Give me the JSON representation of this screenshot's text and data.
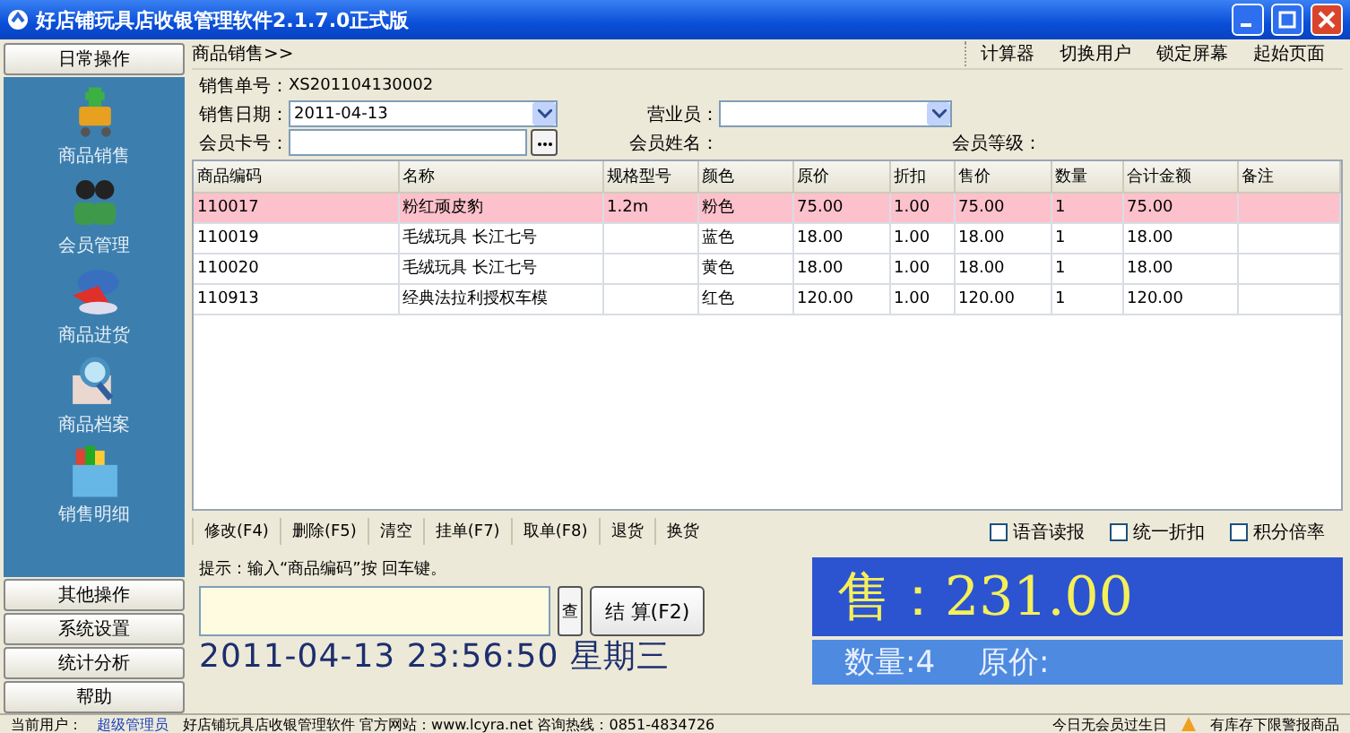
{
  "window": {
    "title": "好店铺玩具店收银管理软件2.1.7.0正式版"
  },
  "sidebar": {
    "header": "日常操作",
    "items": [
      {
        "label": "商品销售"
      },
      {
        "label": "会员管理"
      },
      {
        "label": "商品进货"
      },
      {
        "label": "商品档案"
      },
      {
        "label": "销售明细"
      }
    ],
    "footer_buttons": [
      "其他操作",
      "系统设置",
      "统计分析",
      "帮助"
    ]
  },
  "breadcrumb": "商品销售>>",
  "toolbar": [
    "计算器",
    "切换用户",
    "锁定屏幕",
    "起始页面"
  ],
  "form": {
    "order_no": {
      "label": "销售单号：",
      "value": "XS201104130002"
    },
    "date": {
      "label": "销售日期：",
      "value": "2011-04-13"
    },
    "clerk": {
      "label": "营业员："
    },
    "card": {
      "label": "会员卡号："
    },
    "member_name": {
      "label": "会员姓名："
    },
    "member_level": {
      "label": "会员等级："
    }
  },
  "table": {
    "columns": [
      "商品编码",
      "名称",
      "规格型号",
      "颜色",
      "原价",
      "折扣",
      "售价",
      "数量",
      "合计金额",
      "备注"
    ],
    "rows": [
      {
        "selected": true,
        "cells": [
          "110017",
          "粉红顽皮豹",
          "1.2m",
          "粉色",
          "75.00",
          "1.00",
          "75.00",
          "1",
          "75.00",
          ""
        ]
      },
      {
        "selected": false,
        "cells": [
          "110019",
          "毛绒玩具 长江七号",
          "",
          "蓝色",
          "18.00",
          "1.00",
          "18.00",
          "1",
          "18.00",
          ""
        ]
      },
      {
        "selected": false,
        "cells": [
          "110020",
          "毛绒玩具 长江七号",
          "",
          "黄色",
          "18.00",
          "1.00",
          "18.00",
          "1",
          "18.00",
          ""
        ]
      },
      {
        "selected": false,
        "cells": [
          "110913",
          "经典法拉利授权车模",
          "",
          "红色",
          "120.00",
          "1.00",
          "120.00",
          "1",
          "120.00",
          ""
        ]
      }
    ]
  },
  "actions": [
    "修改(F4)",
    "删除(F5)",
    "清空",
    "挂单(F7)",
    "取单(F8)",
    "退货",
    "换货"
  ],
  "options": [
    {
      "label": "语音读报",
      "checked": false
    },
    {
      "label": "统一折扣",
      "checked": false
    },
    {
      "label": "积分倍率",
      "checked": false
    }
  ],
  "hint": "提示：输入“商品编码”按 回车键。",
  "lookup_button": "查",
  "checkout_button": "结 算(F2)",
  "clock": "2011-04-13 23:56:50 星期三",
  "display": {
    "total_label": "售：",
    "total": "231.00",
    "quantity": "数量:4",
    "original_label": "原价:"
  },
  "status_bar": {
    "user_label": "当前用户：",
    "user": "超级管理员",
    "info": "好店铺玩具店收银管理软件 官方网站：www.lcyra.net 咨询热线：0851-4834726",
    "birthday": "今日无会员过生日",
    "stock_alert": "有库存下限警报商品"
  }
}
